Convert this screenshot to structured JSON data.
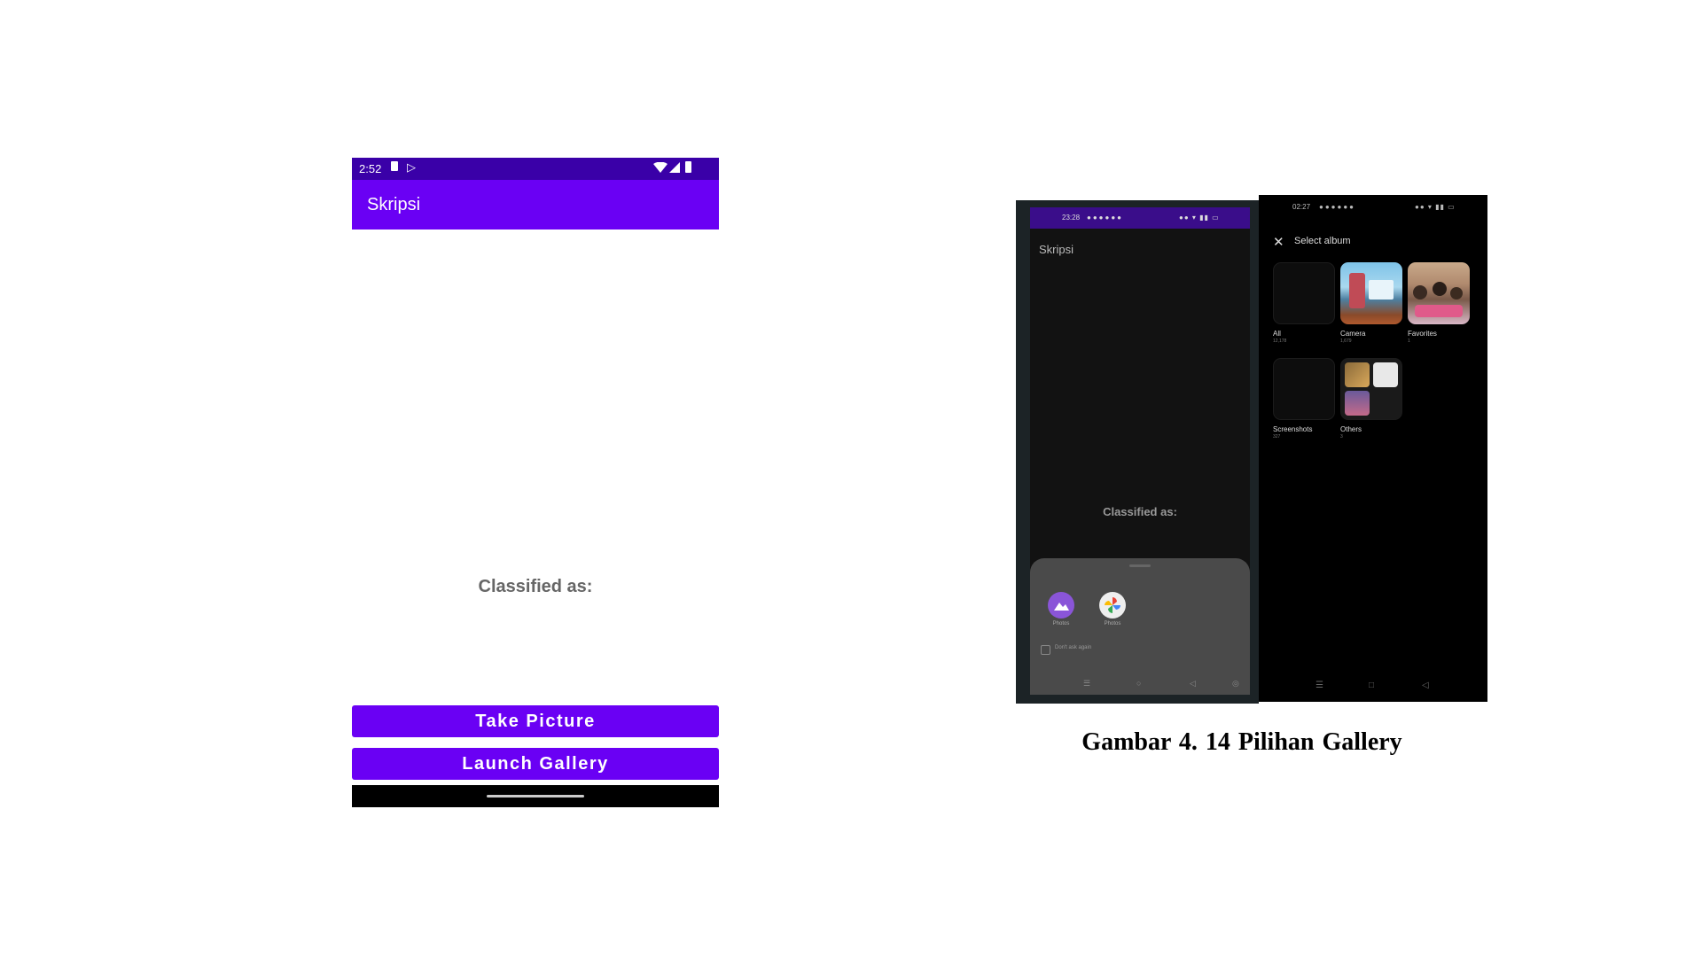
{
  "left_phone": {
    "status": {
      "time": "2:52",
      "icons": [
        "sd-card-icon",
        "play-protect-icon",
        "wifi-icon",
        "signal-icon",
        "battery-icon"
      ]
    },
    "app_title": "Skripsi",
    "classified_label": "Classified as:",
    "take_picture_label": "Take Picture",
    "launch_gallery_label": "Launch Gallery",
    "colors": {
      "status_bar": "#3a00a8",
      "app_bar": "#6a00f4",
      "button": "#6a00f4"
    }
  },
  "right_phone_chooser": {
    "status": {
      "time": "23:28"
    },
    "app_title": "Skripsi",
    "classified_label": "Classified as:",
    "apps": [
      {
        "name": "Photos",
        "icon": "photos-app-icon"
      },
      {
        "name": "Photos",
        "icon": "google-photos-icon"
      }
    ],
    "just_once": "Don't ask again"
  },
  "right_phone_album": {
    "status": {
      "time": "02:27"
    },
    "header": "Select album",
    "albums": [
      {
        "name": "All",
        "count": "12,178"
      },
      {
        "name": "Camera",
        "count": "1,679"
      },
      {
        "name": "Favorites",
        "count": "1"
      },
      {
        "name": "Screenshots",
        "count": "327"
      },
      {
        "name": "Others",
        "count": "3"
      }
    ]
  },
  "caption": "Gambar 4.  14 Pilihan Gallery"
}
